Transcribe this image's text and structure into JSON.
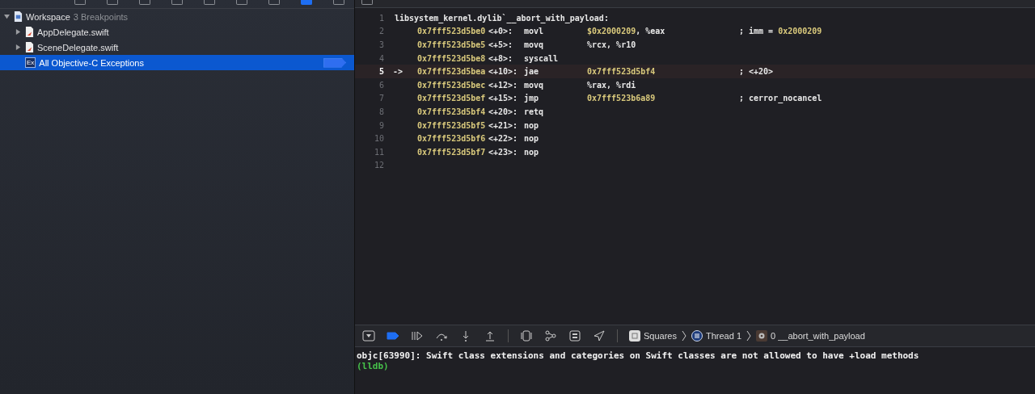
{
  "navigator": {
    "items": [
      {
        "label": "Workspace",
        "subtitle": "3 Breakpoints",
        "kind": "workspace",
        "expanded": true,
        "selected": false,
        "children": [
          {
            "label": "AppDelegate.swift",
            "kind": "file",
            "expanded": false,
            "selected": false
          },
          {
            "label": "SceneDelegate.swift",
            "kind": "file",
            "expanded": false,
            "selected": false
          },
          {
            "label": "All Objective-C Exceptions",
            "icon_text": "Ex",
            "kind": "exception",
            "selected": true,
            "enabled": true
          }
        ]
      }
    ]
  },
  "editor": {
    "lines": [
      {
        "number": "1",
        "current": false,
        "label": "libsystem_kernel.dylib`__abort_with_payload:"
      },
      {
        "number": "2",
        "current": false,
        "address": "0x7fff523d5be0",
        "offset": "<+0>:",
        "mnemonic": "movl",
        "operands": [
          {
            "text": "$0x2000209",
            "kind": "num"
          },
          {
            "text": ", %eax",
            "kind": "plain"
          }
        ],
        "comment": [
          {
            "text": "; imm = ",
            "kind": "plain"
          },
          {
            "text": "0x2000209",
            "kind": "num"
          }
        ]
      },
      {
        "number": "3",
        "current": false,
        "address": "0x7fff523d5be5",
        "offset": "<+5>:",
        "mnemonic": "movq",
        "operands": [
          {
            "text": "%rcx, %r10",
            "kind": "plain"
          }
        ]
      },
      {
        "number": "4",
        "current": false,
        "address": "0x7fff523d5be8",
        "offset": "<+8>:",
        "mnemonic": "syscall"
      },
      {
        "number": "5",
        "current": true,
        "marker": "->",
        "address": "0x7fff523d5bea",
        "offset": "<+10>:",
        "mnemonic": "jae",
        "operands": [
          {
            "text": "0x7fff523d5bf4",
            "kind": "num"
          }
        ],
        "comment": [
          {
            "text": "; <+20>",
            "kind": "plain"
          }
        ]
      },
      {
        "number": "6",
        "current": false,
        "address": "0x7fff523d5bec",
        "offset": "<+12>:",
        "mnemonic": "movq",
        "operands": [
          {
            "text": "%rax, %rdi",
            "kind": "plain"
          }
        ]
      },
      {
        "number": "7",
        "current": false,
        "address": "0x7fff523d5bef",
        "offset": "<+15>:",
        "mnemonic": "jmp",
        "operands": [
          {
            "text": "0x7fff523b6a89",
            "kind": "num"
          }
        ],
        "comment": [
          {
            "text": "; cerror_nocancel",
            "kind": "plain"
          }
        ]
      },
      {
        "number": "8",
        "current": false,
        "address": "0x7fff523d5bf4",
        "offset": "<+20>:",
        "mnemonic": "retq"
      },
      {
        "number": "9",
        "current": false,
        "address": "0x7fff523d5bf5",
        "offset": "<+21>:",
        "mnemonic": "nop"
      },
      {
        "number": "10",
        "current": false,
        "address": "0x7fff523d5bf6",
        "offset": "<+22>:",
        "mnemonic": "nop"
      },
      {
        "number": "11",
        "current": false,
        "address": "0x7fff523d5bf7",
        "offset": "<+23>:",
        "mnemonic": "nop"
      },
      {
        "number": "12",
        "current": false
      }
    ]
  },
  "debug_bar": {
    "breakpoints_active": true,
    "breadcrumb": [
      {
        "label": "Squares",
        "kind": "app"
      },
      {
        "label": "Thread 1",
        "kind": "thread"
      },
      {
        "label": "0 __abort_with_payload",
        "kind": "frame"
      }
    ]
  },
  "console": {
    "lines": [
      {
        "text": "objc[63990]: Swift class extensions and categories on Swift classes are not allowed to have +load methods",
        "kind": "output"
      },
      {
        "text": "(lldb)",
        "kind": "prompt"
      }
    ]
  }
}
